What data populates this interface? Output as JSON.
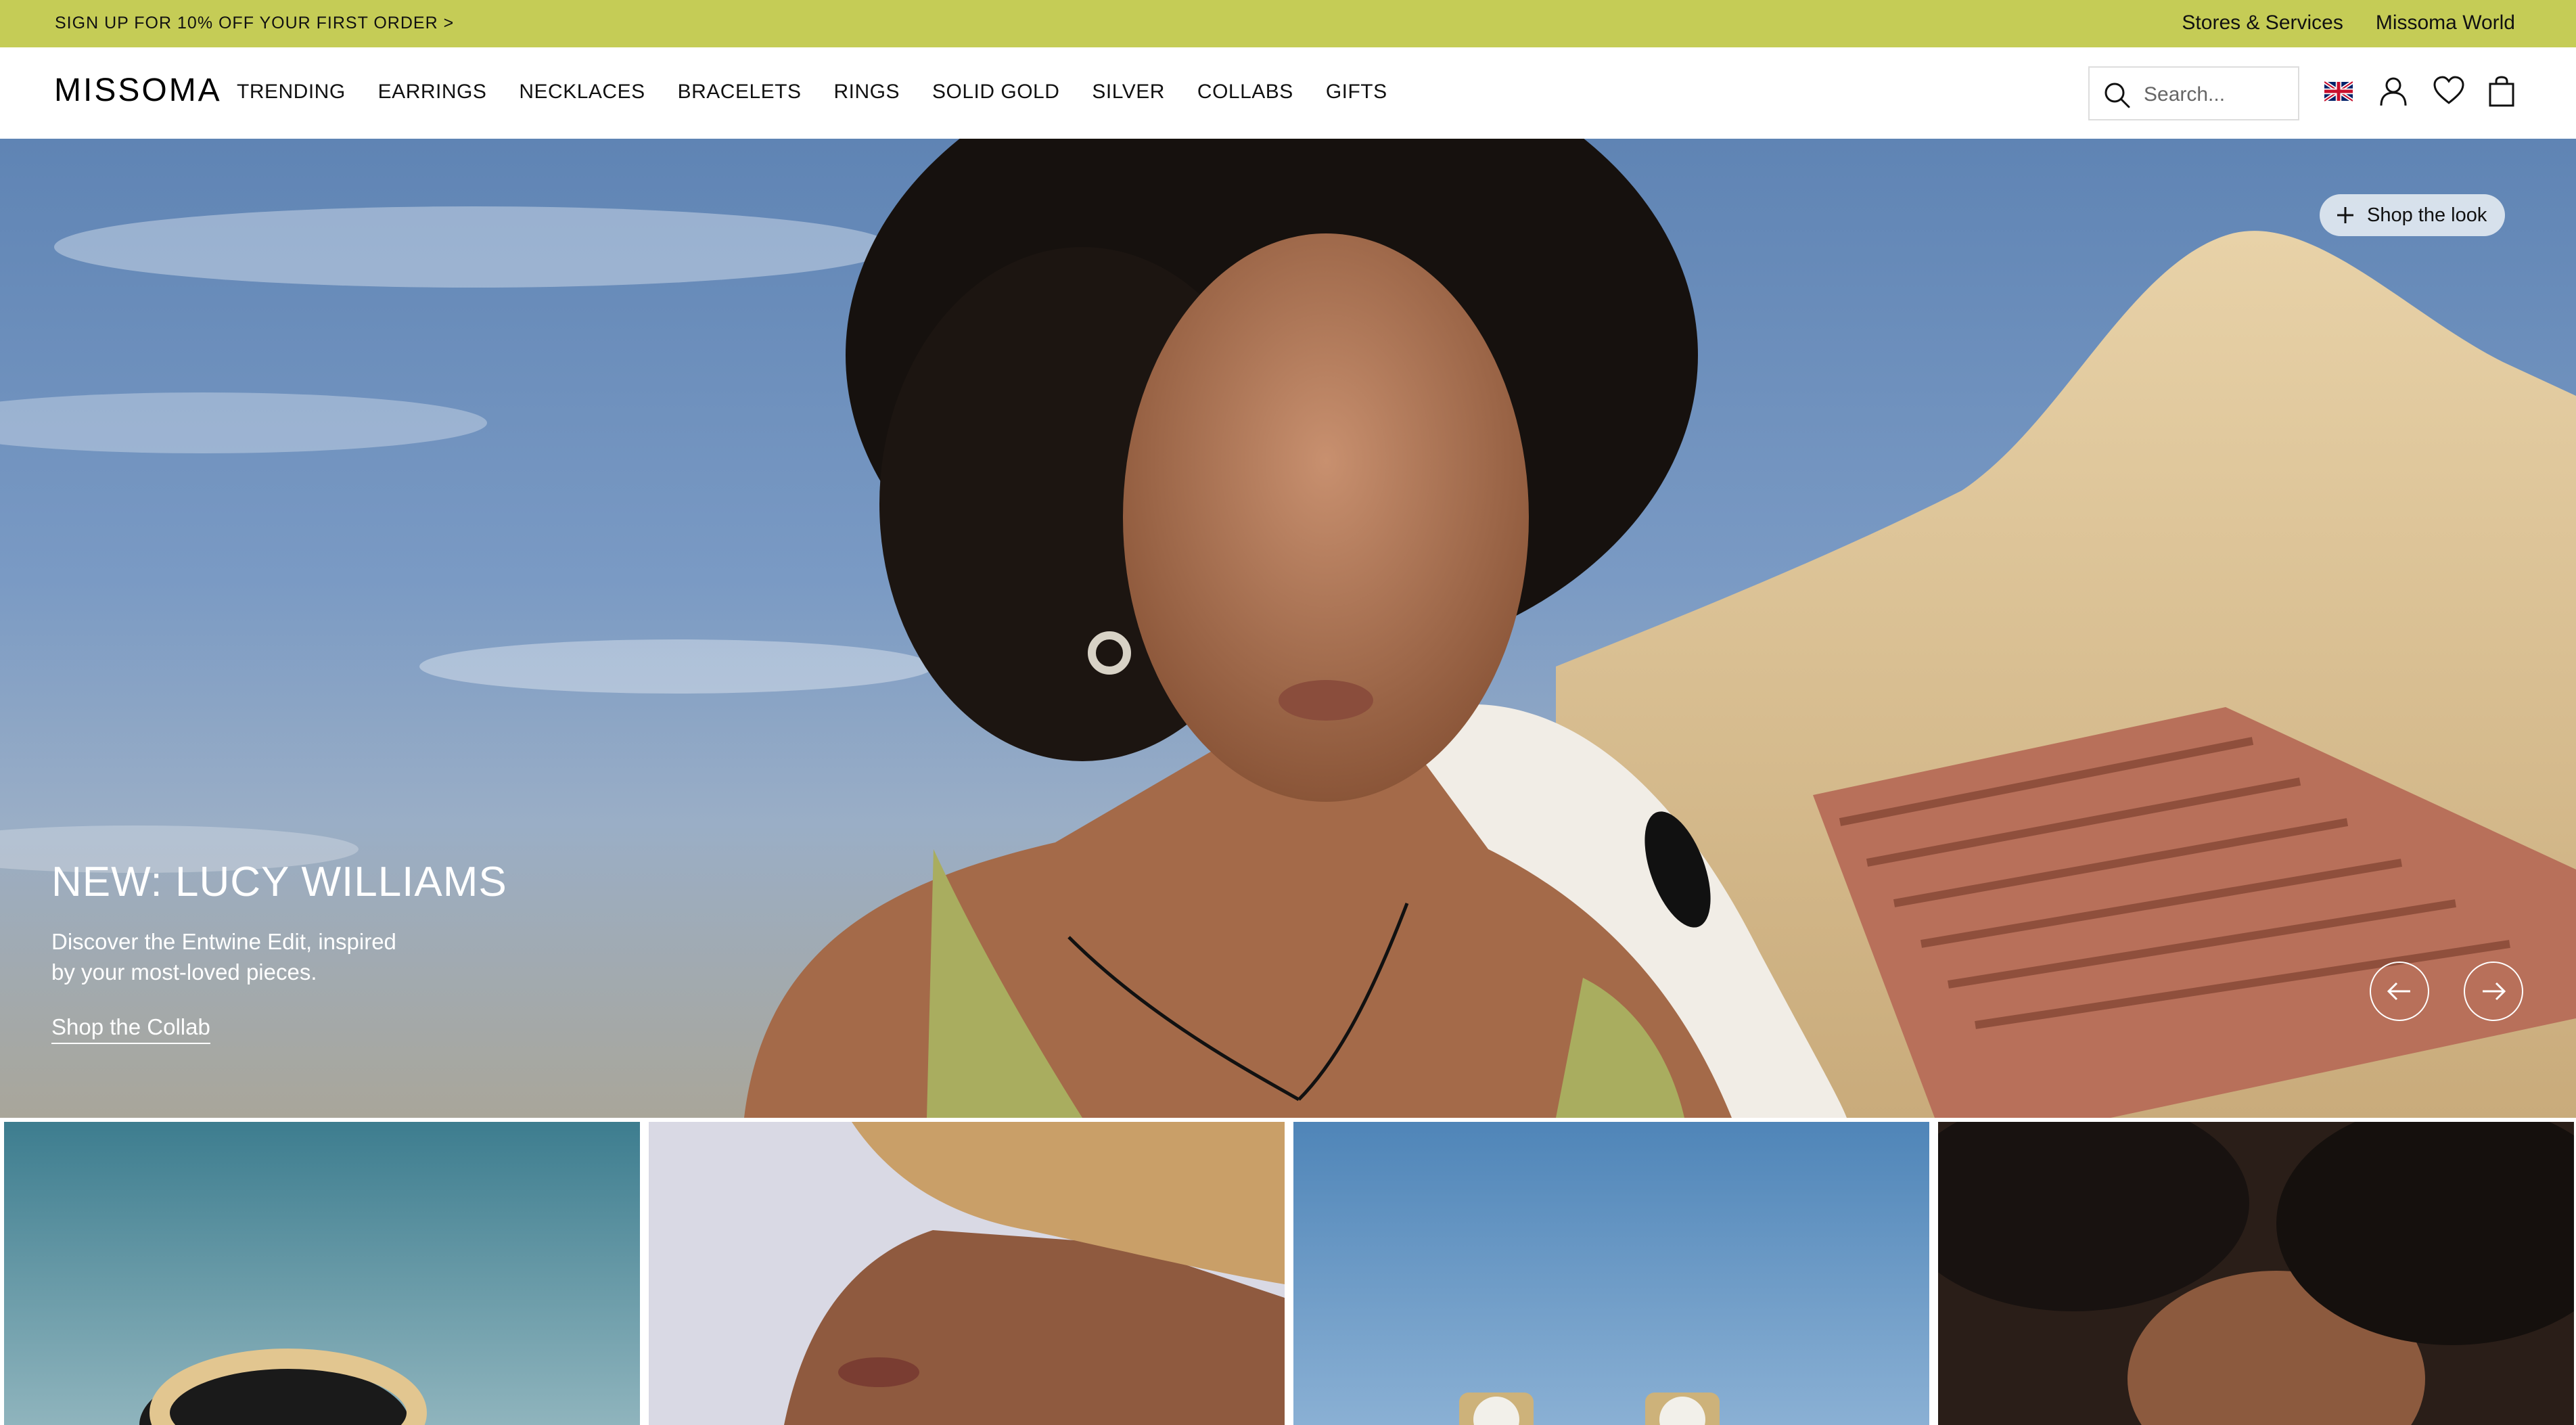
{
  "promo": {
    "text": "SIGN UP FOR 10% OFF YOUR FIRST ORDER >",
    "links": [
      "Stores & Services",
      "Missoma World"
    ],
    "color": "#c5cc56"
  },
  "header": {
    "logo": "MISSOMA",
    "nav": [
      "TRENDING",
      "EARRINGS",
      "NECKLACES",
      "BRACELETS",
      "RINGS",
      "SOLID GOLD",
      "SILVER",
      "COLLABS",
      "GIFTS"
    ],
    "search_placeholder": "Search...",
    "icons": [
      "uk-flag-icon",
      "account-icon",
      "wishlist-heart-icon",
      "bag-icon"
    ]
  },
  "hero": {
    "shop_the_look": "Shop the look",
    "title": "NEW: LUCY WILLIAMS",
    "subtitle_line1": "Discover the Entwine Edit, inspired",
    "subtitle_line2": "by your most-loved pieces.",
    "cta": "Shop the Collab",
    "controls": [
      "arrow-left-icon",
      "arrow-right-icon"
    ]
  },
  "tiles": [
    {
      "name": "tile-gold-ring"
    },
    {
      "name": "tile-straw-hat"
    },
    {
      "name": "tile-pearl-earrings"
    },
    {
      "name": "tile-curly-hair"
    }
  ]
}
